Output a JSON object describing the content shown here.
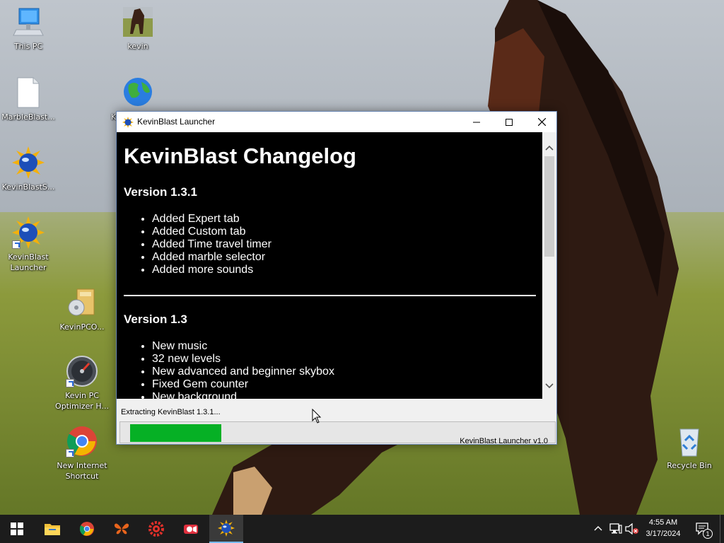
{
  "desktop": {
    "icons": [
      {
        "label": "This PC",
        "icon": "computer-icon"
      },
      {
        "label": "kevin",
        "icon": "horse-photo-icon"
      },
      {
        "label": "MarbleBlast...",
        "icon": "blank-file-icon"
      },
      {
        "label": "K",
        "icon": "globe-icon"
      },
      {
        "label": "KevinBlastS...",
        "icon": "kevinblast-icon"
      },
      {
        "label": "KevinBlast Launcher",
        "icon": "kevinblast-icon"
      },
      {
        "label": "KevinPCO...",
        "icon": "installer-box-icon"
      },
      {
        "label": "Kevin PC Optimizer H...",
        "icon": "speedometer-icon"
      },
      {
        "label": "New Internet Shortcut",
        "icon": "chrome-icon"
      },
      {
        "label": "Recycle Bin",
        "icon": "recycle-bin-icon"
      }
    ]
  },
  "window": {
    "title": "KevinBlast Launcher",
    "changelog": {
      "heading": "KevinBlast Changelog",
      "versions": [
        {
          "name": "Version 1.3.1",
          "items": [
            "Added Expert tab",
            "Added Custom tab",
            "Added Time travel timer",
            "Added marble selector",
            "Added more sounds"
          ]
        },
        {
          "name": "Version 1.3",
          "items": [
            "New music",
            "32 new levels",
            "New advanced and beginner skybox",
            "Fixed Gem counter",
            "New background"
          ]
        }
      ]
    },
    "status_text": "Extracting KevinBlast 1.3.1...",
    "progress": 0.22,
    "version_label": "KevinBlast Launcher v1.0"
  },
  "taskbar": {
    "apps": [
      "start-icon",
      "file-explorer-icon",
      "chrome-icon",
      "butterfly-icon",
      "red-gear-icon",
      "video-recorder-icon",
      "kevinblast-icon"
    ],
    "time": "4:55 AM",
    "date": "3/17/2024",
    "notification_count": "1"
  },
  "colors": {
    "progress_fill": "#06b025",
    "taskbar_bg": "#1c1c1c",
    "content_bg": "#000000"
  }
}
